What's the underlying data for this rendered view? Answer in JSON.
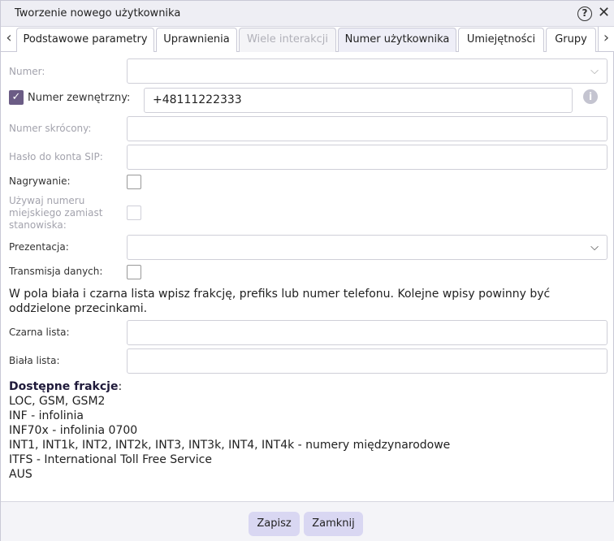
{
  "window": {
    "title": "Tworzenie nowego użytkownika",
    "help_icon": "?",
    "close_icon": "✕"
  },
  "tabs": {
    "prev_arrow": "‹",
    "next_arrow": "›",
    "items": [
      {
        "label": "Podstawowe parametry",
        "state": "normal"
      },
      {
        "label": "Uprawnienia",
        "state": "normal"
      },
      {
        "label": "Wiele interakcji",
        "state": "disabled"
      },
      {
        "label": "Numer użytkownika",
        "state": "active"
      },
      {
        "label": "Umiejętności",
        "state": "normal"
      },
      {
        "label": "Grupy",
        "state": "normal"
      }
    ]
  },
  "form": {
    "numer": {
      "label": "Numer:",
      "value": ""
    },
    "numer_zewnetrzny": {
      "label": "Numer zewnętrzny:",
      "checked": true,
      "check_mark": "✓",
      "value": "+48111222333",
      "info_icon": "i"
    },
    "numer_skrocony": {
      "label": "Numer skrócony:",
      "value": ""
    },
    "haslo_sip": {
      "label": "Hasło do konta SIP:",
      "value": ""
    },
    "nagrywanie": {
      "label": "Nagrywanie:",
      "checked": false
    },
    "uzywaj_numeru": {
      "label_lines": [
        "Używaj numeru",
        "miejskiego zamiast",
        "stanowiska:"
      ],
      "checked": false
    },
    "prezentacja": {
      "label": "Prezentacja:",
      "value": ""
    },
    "transmisja": {
      "label": "Transmisja danych:",
      "checked": false
    },
    "note_lines": [
      "W pola biała i czarna lista wpisz frakcję, prefiks lub numer telefonu. Kolejne wpisy powinny być",
      "oddzielone przecinkami."
    ],
    "czarna_lista": {
      "label": "Czarna lista:",
      "value": ""
    },
    "biala_lista": {
      "label": "Biała lista:",
      "value": ""
    }
  },
  "frakcje": {
    "header": "Dostępne frakcje",
    "header_suffix": ":",
    "items": [
      "LOC, GSM, GSM2",
      "INF - infolinia",
      "INF70x - infolinia 0700",
      "INT1, INT1k, INT2, INT2k, INT3, INT3k, INT4, INT4k - numery międzynarodowe",
      "ITFS - International Toll Free Service",
      "AUS"
    ]
  },
  "footer": {
    "save_label": "Zapisz",
    "close_label": "Zamknij"
  },
  "colors": {
    "accent": "#6b5c85",
    "button_bg": "#d9d7f2",
    "titlebar_bg": "#eeeef4"
  }
}
